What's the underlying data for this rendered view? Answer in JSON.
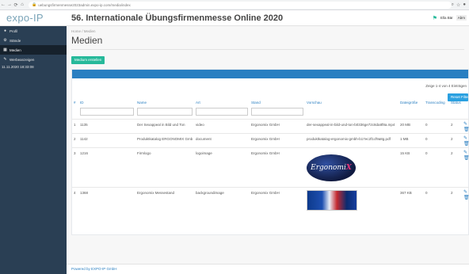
{
  "browser": {
    "url": "uebungsfirmenmesse2023admin.expo-ip.com/media/index",
    "back_icon": "←",
    "forward_icon": "→",
    "reload_icon": "⟳",
    "home_icon": "⌂"
  },
  "header": {
    "logo": "expo-IP",
    "title": "56. Internationale Übungsfirmenmesse Online 2020",
    "user_name": "Ella Bär",
    "abmelden": "Abm"
  },
  "sidebar": {
    "items": [
      {
        "icon": "user-icon",
        "glyph": "👤",
        "label": "Profil"
      },
      {
        "icon": "building-icon",
        "glyph": "⚙",
        "label": "Stände"
      },
      {
        "icon": "media-icon",
        "glyph": "▦",
        "label": "Medien"
      },
      {
        "icon": "newspaper-icon",
        "glyph": "✎",
        "label": "Werbeanzeigen"
      }
    ],
    "timestamp": "11.11.2020 18:33:08"
  },
  "main": {
    "breadcrumb": "Home / Medien",
    "heading": "Medien",
    "create_button": "Medium erstellen",
    "table_info": "Zeige 1-4 von 4 Einträgen",
    "reset_button": "Reset Filter",
    "columns": [
      "#",
      "ID",
      "Name",
      "Art",
      "Stand",
      "Vorschau",
      "Dateigröße",
      "Transcoding",
      "Status"
    ],
    "rows": [
      {
        "num": "1",
        "id": "1135",
        "name": "Der Sexappeal in Bild und Ton",
        "art": "video",
        "stand": "Ergonomix GmbH",
        "vorschau": "der-sexappeal-in-bild-und-ton-b0336ge72c8da8f8a.mp4",
        "size": "20 MB",
        "transcoding": "0",
        "status": "2"
      },
      {
        "num": "2",
        "id": "1142",
        "name": "Produktkatalog ERGONOMIX GmbH",
        "art": "document",
        "stand": "Ergonomix GmbH",
        "vorschau": "produktkatalog-ergonomix-gmbh-b17ec2f1cf9a8g.pdf",
        "size": "1 MB",
        "transcoding": "0",
        "status": "2"
      },
      {
        "num": "3",
        "id": "1216",
        "name": "Firmlogo",
        "art": "logoimage",
        "stand": "Ergonomix GmbH",
        "vorschau": "",
        "size": "15 KB",
        "transcoding": "0",
        "status": "2"
      },
      {
        "num": "4",
        "id": "1368",
        "name": "Ergonomix Messestand",
        "art": "backgroundimage",
        "stand": "Ergonomix GmbH",
        "vorschau": "",
        "size": "367 KB",
        "transcoding": "0",
        "status": "2"
      }
    ],
    "logo_preview_text": "Ergonomi",
    "logo_preview_x": "X"
  },
  "footer": {
    "text": "Powered by EXPO-IP GmbH"
  },
  "colors": {
    "sidebar": "#2a3f54",
    "accent": "#2a7fc1",
    "create": "#26b99a"
  }
}
